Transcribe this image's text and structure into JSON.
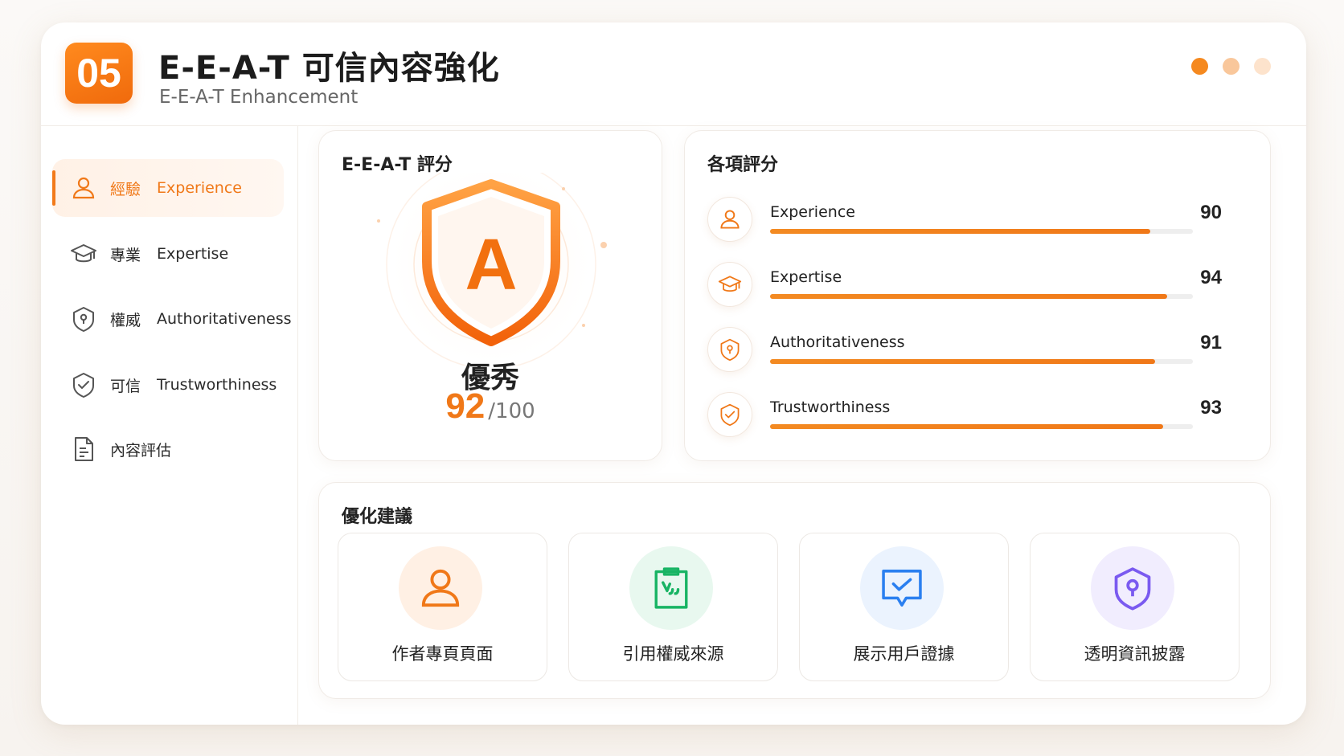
{
  "header": {
    "badge": "05",
    "title": "E-E-A-T 可信內容強化",
    "subtitle": "E-E-A-T Enhancement",
    "dot_colors": [
      "#f5891f",
      "#f9c79b",
      "#fde3cc"
    ]
  },
  "sidebar": {
    "items": [
      {
        "zh": "經驗",
        "en": "Experience",
        "icon": "person-icon",
        "active": true
      },
      {
        "zh": "專業",
        "en": "Expertise",
        "icon": "graduation-cap-icon",
        "active": false
      },
      {
        "zh": "權威",
        "en": "Authoritativeness",
        "icon": "shield-lock-icon",
        "active": false
      },
      {
        "zh": "可信",
        "en": "Trustworthiness",
        "icon": "shield-check-icon",
        "active": false
      },
      {
        "zh": "內容評估",
        "en": "",
        "icon": "document-icon",
        "active": false
      }
    ]
  },
  "score": {
    "title": "E-E-A-T 評分",
    "grade": "A",
    "word": "優秀",
    "value": "92",
    "max": "/100",
    "accent": "#f07818"
  },
  "ratings": {
    "title": "各項評分",
    "items": [
      {
        "label": "Experience",
        "value": 90,
        "icon": "person-icon"
      },
      {
        "label": "Expertise",
        "value": 94,
        "icon": "graduation-cap-icon"
      },
      {
        "label": "Authoritativeness",
        "value": 91,
        "icon": "shield-lock-icon"
      },
      {
        "label": "Trustworthiness",
        "value": 93,
        "icon": "shield-check-icon"
      }
    ]
  },
  "suggestions": {
    "title": "優化建議",
    "items": [
      {
        "label": "作者專頁頁面",
        "icon": "person-icon",
        "color": "#f07818",
        "bg": "#fff0e4"
      },
      {
        "label": "引用權威來源",
        "icon": "quote-clipboard-icon",
        "color": "#18b464",
        "bg": "#e8f8ef"
      },
      {
        "label": "展示用戶證據",
        "icon": "chat-check-icon",
        "color": "#2a7ff0",
        "bg": "#ebf3fe"
      },
      {
        "label": "透明資訊披露",
        "icon": "shield-lock-icon",
        "color": "#7a5af0",
        "bg": "#f1edfe"
      }
    ]
  }
}
